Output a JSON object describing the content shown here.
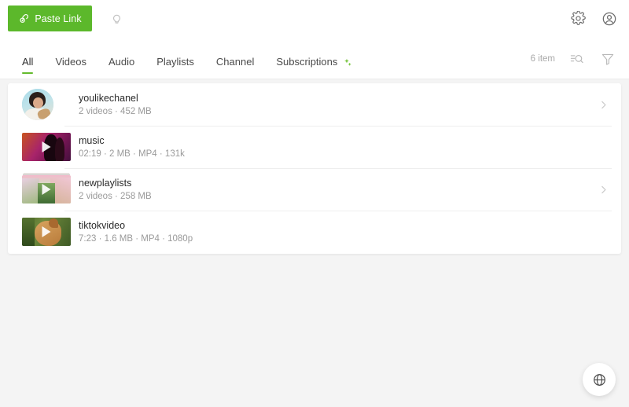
{
  "theme": {
    "accent_green": "#5cb82b",
    "tab_indicator": "#64bb2e",
    "card_background": "#ffffff",
    "page_background": "#f4f4f4"
  },
  "topbar": {
    "paste_button_label": "Paste Link",
    "paste_button_icon": "link-lock-icon",
    "tip_icon": "lightbulb-icon",
    "settings_icon": "gear-icon",
    "account_icon": "account-circle-icon"
  },
  "tabs": [
    {
      "label": "All",
      "active": true
    },
    {
      "label": "Videos",
      "active": false
    },
    {
      "label": "Audio",
      "active": false
    },
    {
      "label": "Playlists",
      "active": false
    },
    {
      "label": "Channel",
      "active": false
    },
    {
      "label": "Subscriptions",
      "active": false,
      "badge_icon": "green-plus-icon"
    }
  ],
  "toolbar": {
    "item_count": "6 item",
    "search_icon": "list-search-icon",
    "filter_icon": "filter-funnel-icon"
  },
  "list": [
    {
      "title": "youlikechanel",
      "subtitle": "2 videos · 452 MB",
      "type": "channel",
      "has_chevron": true,
      "chevron_icon": "chevron-right-icon"
    },
    {
      "title": "music",
      "subtitle": "02:19 · 2 MB · MP4 · 131k",
      "type": "video",
      "has_chevron": false
    },
    {
      "title": "newplaylists",
      "subtitle": "2 videos · 258 MB",
      "type": "playlist",
      "has_chevron": true,
      "chevron_icon": "chevron-right-icon"
    },
    {
      "title": "tiktokvideo",
      "subtitle": "7:23 · 1.6 MB · MP4 · 1080p",
      "type": "video",
      "has_chevron": false
    }
  ],
  "fab": {
    "icon": "globe-icon"
  }
}
